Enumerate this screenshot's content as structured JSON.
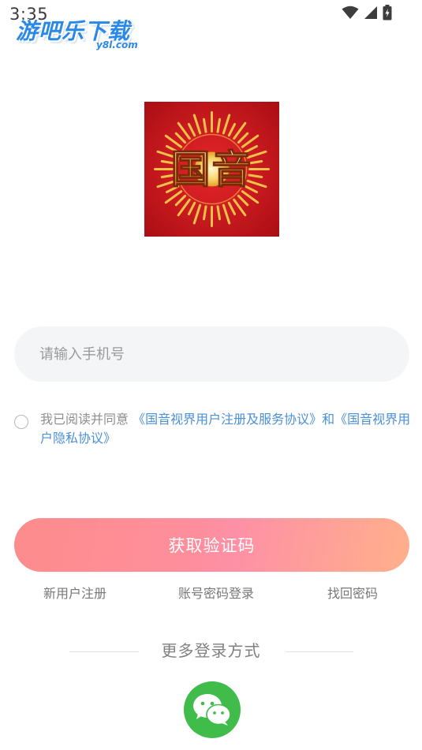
{
  "status_bar": {
    "time": "3:35",
    "icons": [
      "wifi-icon",
      "cellular-signal-icon",
      "battery-icon"
    ]
  },
  "watermark": {
    "title": "游吧乐下载",
    "subtitle": "y8l.com"
  },
  "logo": {
    "text": "国音",
    "icon": "app-logo"
  },
  "phone_input": {
    "placeholder": "请输入手机号",
    "value": ""
  },
  "agreement": {
    "prefix": "我已阅读并同意",
    "link1": "《国音视界用户注册及服务协议》",
    "connector": "和",
    "link2": "《国音视界用户隐私协议》",
    "checked": false
  },
  "primary_button": {
    "label": "获取验证码"
  },
  "links": {
    "register": "新用户注册",
    "password_login": "账号密码登录",
    "forgot_password": "找回密码"
  },
  "more_login": {
    "title": "更多登录方式",
    "methods": [
      "wechat-icon"
    ]
  },
  "colors": {
    "accent_link": "#4a90d9",
    "button_gradient_start": "#fd8c8c",
    "button_gradient_end": "#ffb08b",
    "wechat_green": "#3fbc4a",
    "logo_red": "#c8141a",
    "logo_gold": "#f2c14a"
  }
}
